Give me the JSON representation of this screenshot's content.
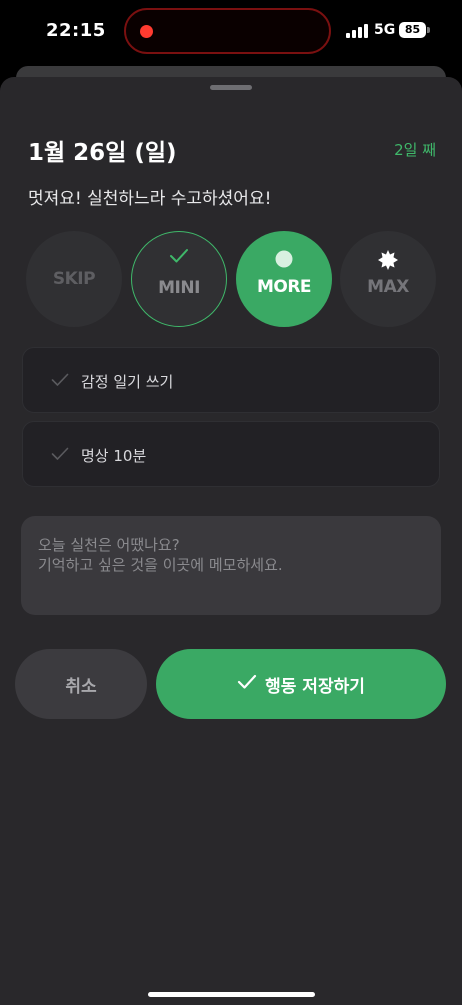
{
  "status_bar": {
    "time": "22:15",
    "network": "5G",
    "battery": "85",
    "icons": [
      "recording-dot-icon",
      "signal-bars-icon",
      "battery-icon"
    ]
  },
  "sheet": {
    "date_title": "1월 26일 (일)",
    "day_count": "2일 째",
    "praise": "멋져요! 실천하느라 수고하셨어요!"
  },
  "levels": [
    {
      "label": "SKIP",
      "selected": false
    },
    {
      "label": "MINI",
      "selected": false,
      "icon": "check-icon"
    },
    {
      "label": "MORE",
      "selected": true,
      "icon": "dot-icon"
    },
    {
      "label": "MAX",
      "selected": false,
      "icon": "burst-icon"
    }
  ],
  "habits": [
    {
      "label": "감정 일기 쓰기",
      "icon": "check-icon"
    },
    {
      "label": "명상 10분",
      "icon": "check-icon"
    }
  ],
  "memo": {
    "placeholder": "오늘 실천은 어땠나요?\n기억하고 싶은 것을 이곳에 메모하세요.",
    "value": ""
  },
  "buttons": {
    "cancel": "취소",
    "save": "행동 저장하기"
  },
  "colors": {
    "accent": "#3aa964",
    "accent_text": "#3fb86a",
    "sheet_bg": "#29282b"
  }
}
